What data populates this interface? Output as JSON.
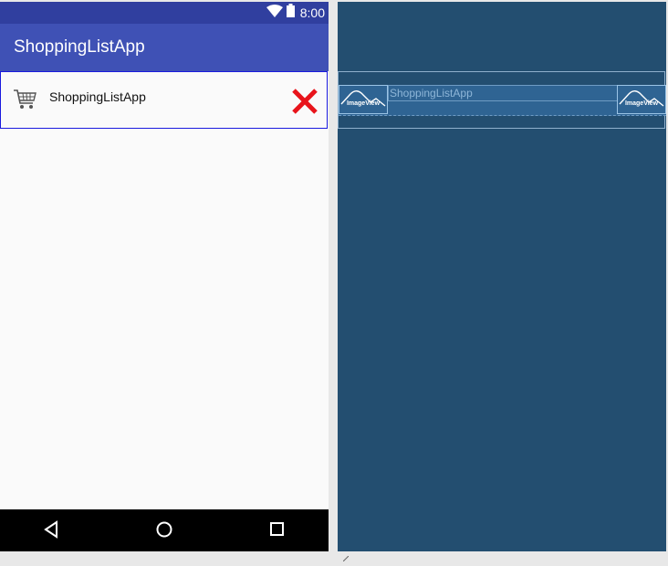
{
  "status_bar": {
    "time": "8:00",
    "icons": [
      "wifi-icon",
      "battery-icon"
    ],
    "color": "#303f9f"
  },
  "app_bar": {
    "title": "ShoppingListApp",
    "color": "#3f51b5"
  },
  "list_item": {
    "label": "ShoppingListApp",
    "leading_icon": "shopping-cart-icon",
    "trailing_icon": "delete-x-icon",
    "trailing_icon_color": "#e8141b"
  },
  "nav_bar": {
    "buttons": [
      "back-icon",
      "home-icon",
      "recents-icon"
    ]
  },
  "blueprint": {
    "background": "#234e70",
    "image_view_left": "ImageView",
    "image_view_right": "ImageView",
    "text_view": "ShoppingListApp"
  }
}
